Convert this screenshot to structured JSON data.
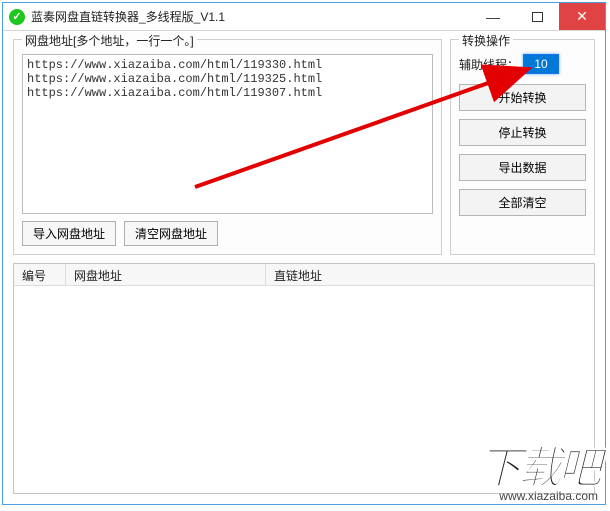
{
  "title": "蓝奏网盘直链转换器_多线程版_V1.1",
  "window_controls": {
    "min": "—",
    "close": "✕"
  },
  "address_group": {
    "label": "网盘地址[多个地址，一行一个。]",
    "text": "https://www.xiazaiba.com/html/119330.html\nhttps://www.xiazaiba.com/html/119325.html\nhttps://www.xiazaiba.com/html/119307.html",
    "import_btn": "导入网盘地址",
    "clear_btn": "清空网盘地址"
  },
  "ops_group": {
    "label": "转换操作",
    "thread_label": "辅助线程：",
    "thread_value": "10",
    "start_btn": "开始转换",
    "stop_btn": "停止转换",
    "export_btn": "导出数据",
    "clear_all_btn": "全部清空"
  },
  "table": {
    "cols": [
      "编号",
      "网盘地址",
      "直链地址"
    ]
  },
  "watermark": {
    "big": "下载吧",
    "url": "www.xiazaiba.com"
  }
}
